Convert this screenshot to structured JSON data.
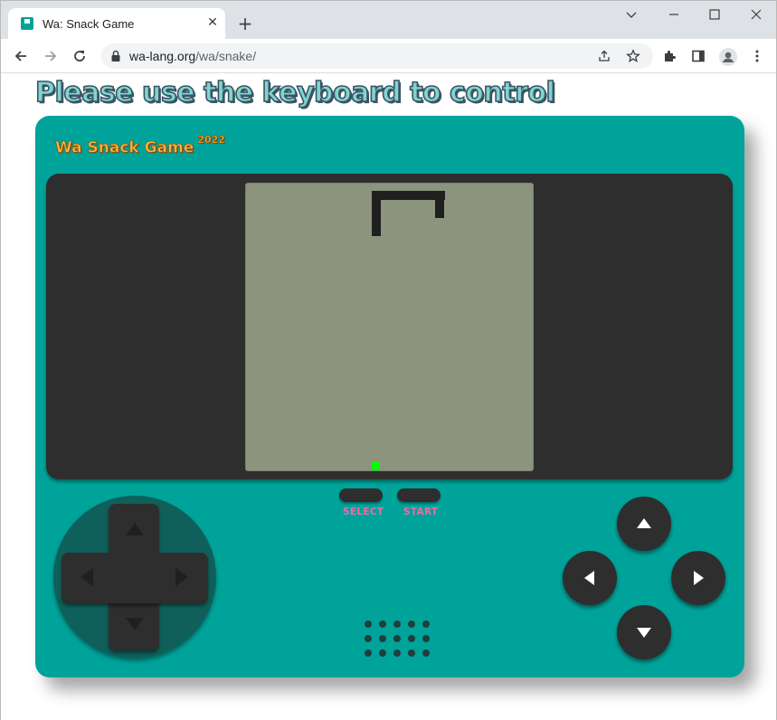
{
  "browser": {
    "tab_title": "Wa: Snack Game",
    "tab_close": "✕",
    "new_tab": "+",
    "url_host": "wa-lang.org",
    "url_path": "/wa/snake/"
  },
  "page": {
    "headline": "Please use the keyboard to control",
    "brand": "Wa Snack Game",
    "brand_year": "2022",
    "select_label": "SELECT",
    "start_label": "START"
  },
  "colors": {
    "console": "#00a39a",
    "screen": "#8c947e",
    "snake": "#1f1f1f",
    "food": "#00ff00",
    "button_label": "#f06aa8",
    "brand": "#f5b53b"
  },
  "icons": [
    "app-favicon",
    "close-icon",
    "plus-icon",
    "chevron-down-icon",
    "minimize-icon",
    "maximize-icon",
    "close-window-icon",
    "back-arrow-icon",
    "forward-arrow-icon",
    "reload-icon",
    "lock-icon",
    "share-icon",
    "star-icon",
    "extensions-icon",
    "sidepanel-icon",
    "profile-icon",
    "kebab-menu-icon"
  ]
}
